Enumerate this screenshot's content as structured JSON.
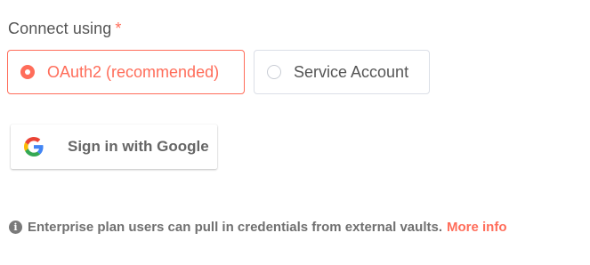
{
  "connect": {
    "label": "Connect using",
    "required_mark": "*",
    "options": [
      {
        "label": "OAuth2 (recommended)",
        "selected": true
      },
      {
        "label": "Service Account",
        "selected": false
      }
    ]
  },
  "google_signin": {
    "label": "Sign in with Google",
    "icon": "google-g-icon"
  },
  "info": {
    "icon": "info-icon",
    "icon_glyph": "i",
    "text": "Enterprise plan users can pull in credentials from external vaults.",
    "link_text": "More info"
  },
  "colors": {
    "accent": "#ff6d5a",
    "text": "#555555",
    "border": "#dbdfe7"
  }
}
